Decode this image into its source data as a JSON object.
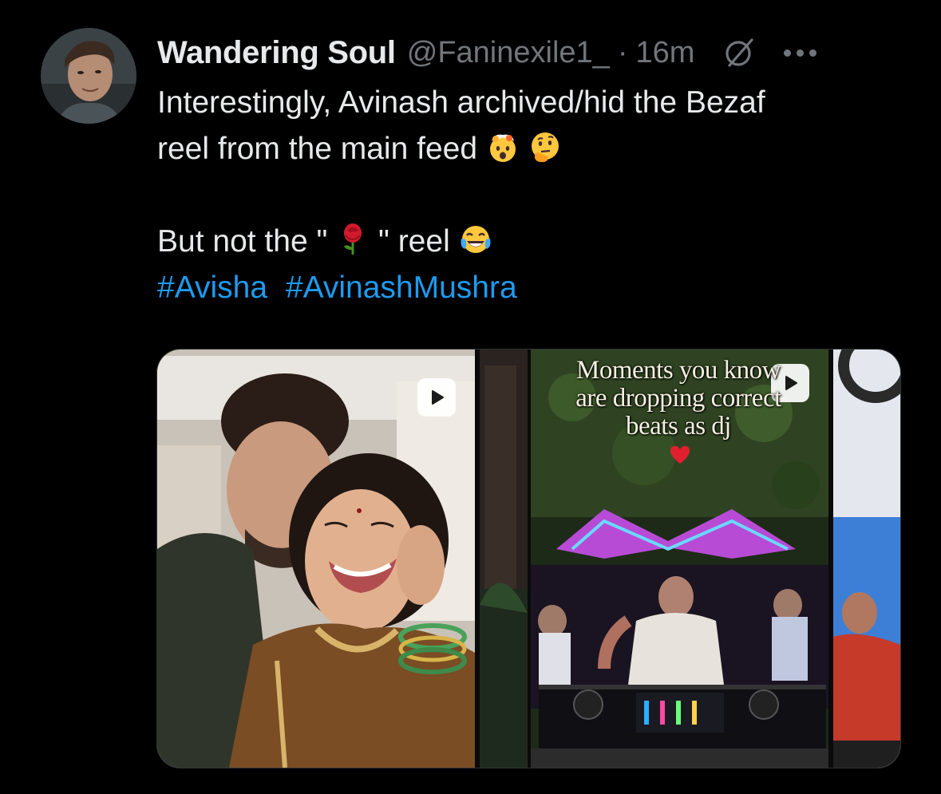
{
  "tweet": {
    "author": {
      "display_name": "Wandering Soul",
      "handle": "@Faninexile1_",
      "avatar_icon": "user-avatar"
    },
    "separator": "·",
    "time": "16m",
    "icons": {
      "grok": "grok-icon",
      "more": "more-options-icon"
    },
    "text": {
      "line1": "Interestingly, Avinash archived/hid the Bezaf",
      "line2": "reel from the main feed",
      "line2_emojis": [
        "exploding-head-emoji",
        "thinking-face-emoji"
      ],
      "line3_start": "But not the \"",
      "line3_emoji_mid": "rose-emoji",
      "line3_end": "\" reel",
      "line3_emoji_end": "tears-of-joy-emoji"
    },
    "hashtags": [
      "#Avisha",
      "#AvinashMushra"
    ],
    "colors": {
      "background": "#000000",
      "text": "#e7e9ea",
      "secondary": "#71767b",
      "link": "#1d9bf0"
    },
    "media": {
      "tile1": {
        "kind": "reel-thumbnail",
        "icon": "reel-play-icon"
      },
      "tile2": {
        "kind": "reel-thumbnail",
        "icon": "reel-play-icon",
        "caption_line1": "Moments you know",
        "caption_line2": "are dropping correct",
        "caption_line3": "beats as dj",
        "caption_emoji": "red-heart-emoji"
      },
      "tile3": {
        "kind": "reel-thumbnail-partial"
      }
    }
  }
}
